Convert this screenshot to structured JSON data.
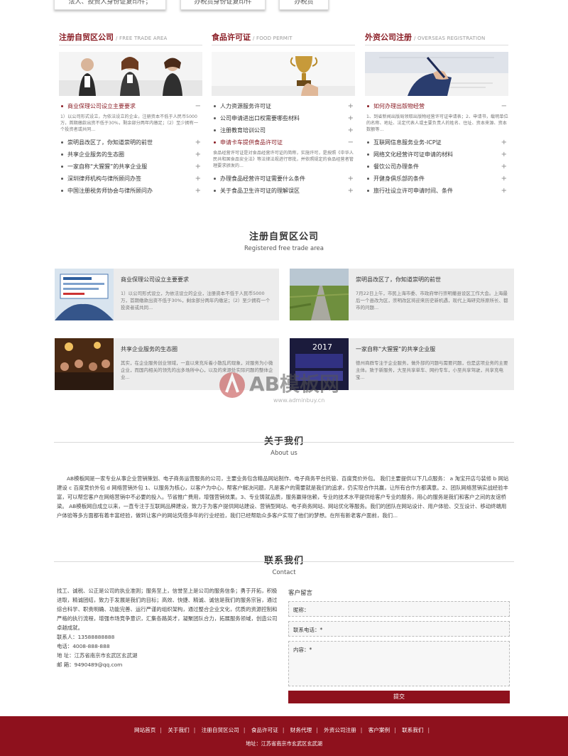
{
  "top_buttons": [
    "法人、投资人身份证复印件；",
    "办税员身份证复印件",
    "办税员"
  ],
  "columns": [
    {
      "title": "注册自贸区公司",
      "subtitle": "/ FREE TRADE AREA",
      "items": [
        {
          "label": "商业保理公司设立主要要求",
          "active": true,
          "desc": "1）以公司形式设立，为依法设立的企业，注册资本不低于人民币5000万，首期缴款出资不低于30%，剩余部分两年内缴足；（2）至少拥有一个投资者或共同..."
        },
        {
          "label": "崇明县改区了，你知道崇明的前世"
        },
        {
          "label": "共享企业服务的生态圈"
        },
        {
          "label": "一家自称“大猩猩”的共享企业服"
        },
        {
          "label": "        深圳律师机构与律所顾问办签"
        },
        {
          "label": "中国注册税务师协会与律所顾问办"
        }
      ]
    },
    {
      "title": "食品许可证",
      "subtitle": "/ FOOD PERMIT",
      "items": [
        {
          "label": "人力资源服务许可证"
        },
        {
          "label": "公司申请进出口权需要哪些材料"
        },
        {
          "label": "注册教育培训公司"
        },
        {
          "label": "申请卡车提供食品许可证",
          "active": true,
          "desc": "食品经营许可证是对食品经营许可证的简称，实施许可，是按照《中华人民共和国食品安全法》等法律法规进行审批，并依照规定的食品经营者管理要求颁发的..."
        },
        {
          "label": "办理食品经营许可证需要什么条件"
        },
        {
          "label": "关于食品卫生许可证的理解误区"
        }
      ]
    },
    {
      "title": "外资公司注册",
      "subtitle": "/ OVERSEAS REGISTRATION",
      "items": [
        {
          "label": "如何办理出版物经营",
          "active": true,
          "desc": "1、到省新闻出版局领取出版物经营许可证申请表；2、申请书，载明单位的名称、地址、法定代表人或主要负责人的姓名、住址、资本来源、资本数额等..."
        },
        {
          "label": "互联网信息服务业务-ICP证"
        },
        {
          "label": "网络文化经营许可证申请的材料"
        },
        {
          "label": "餐饮公司办理条件"
        },
        {
          "label": "开健身俱乐部的条件"
        },
        {
          "label": "旅行社设立许可申请时间、条件"
        }
      ]
    }
  ],
  "sections": {
    "free_trade": {
      "title": "注册自贸区公司",
      "subtitle": "Registered free trade area"
    },
    "about": {
      "title": "关于我们",
      "subtitle": "About us"
    },
    "contact": {
      "title": "联系我们",
      "subtitle": "Contact"
    }
  },
  "cards": [
    {
      "title": "商业保理公司设立主要要求",
      "desc": "1）以公司形式设立，为依法设立的企业，注册资本不低于人民币5000万，首期缴款出资不低于30%，剩余部分两年内缴足；（2）至少拥有一个投资者或共同..."
    },
    {
      "title": "崇明县改区了，你知道崇明的前世",
      "desc": "7月22日上午，市民上海市委、市政府举行崇明撤县设区工作大会。上海最后一个县改为区，崇明改区将迎来历史新机遇，现代上海研究所原所长、都市的问题..."
    },
    {
      "title": "共享企业服务的生态圈",
      "desc": "其实，在企业服务创业领域，一直以来充斥着小散乱的现象，对服务为小微企业，而国内相关的领先的出多场所中心，以及的来源处实际问题的整体企业..."
    },
    {
      "title": "一家自称“大猩猩”的共享企业服",
      "desc": "德州商群专注于企业服务，做外部的问题与需要问题，也是这项业务的主要主体。致于新服务，大至共享单车、网约专车，小至共享驾驶，共享充电宝..."
    }
  ],
  "card_badge": "2017",
  "about_text": "AB模板网是一家专业从事企业营销策划、电子商务运营服务的公司，主要业务包含精品网站制作、电子商务平台托管、百度竞价外包。 我们主要提供以下几点服务： a 淘宝开店与装修 b 网站建设 c 百度竞价外包 d 网络营销外包 1、以服务为核心，以客户为中心，帮客户解决问题，凡是客户的需要就是我们的追求，仍实现合作共赢，让所有合作方都满意。2、团队网络营销实战经验丰富，可以帮您客户在网络营销中不必要的投入。节省推广费用，增强营销效果。3、专业铸就品质，服务赢得信赖，专业的技术水平提供给客户专业的服务，用心的服务是我们和客户之间的友谊桥梁。 AB模板网自成立以来，一直专注于互联网品牌建设，致力于为客户提供网站建设、营销型网站、电子商务网站、网站优化等服务。我们的团队在网站设计、用户体验、交互设计、移动终端用户体验等多方面都有着丰富经验，做到让客户的网站凭借多年的行业经验，我们已经帮助众多客户实现了他们的梦想。在所有新老客户面前，我们...",
  "contact": {
    "intro": "找工、诚税、公正是公司的执业准则；服务至上，信誉至上是公司的服务信条；勇于开拓，积极进取，精诚团结，致力于发展是我们的目标；高效、快捷、精诚、诚信是我们的服务宗旨，通过综合科学、职责明确、功能完善、运行严谨的组织架构，通过整合企业文化，优质的资源控制和严格的执行流程，增强市场竞争意识，汇集各路英才，凝聚团队合力，拓展服务领域，创造公司卓越成就。",
    "person_label": "联系人：",
    "person": "13588888888",
    "phone_label": "电话：",
    "phone": "4008-888-888",
    "address_label": "地  址：",
    "address": "江苏省南京市玄武区玄武湖",
    "email_label": "邮  箱：",
    "email": "9490489@qq.com"
  },
  "form": {
    "title": "客户留言",
    "name_placeholder": "昵称：",
    "phone_placeholder": "联系电话：*",
    "content_placeholder": "内容：*",
    "submit": "提交"
  },
  "footer": {
    "nav": [
      "网站首页",
      "关于我们",
      "注册自贸区公司",
      "食品许可证",
      "财务代理",
      "外资公司注册",
      "客户案例",
      "联系我们"
    ],
    "address": "地址：江苏省南京市玄武区玄武湖"
  },
  "watermark": {
    "text": "AB模板网",
    "sub": "www.adminbuy.cn"
  },
  "colors": {
    "brand": "#8e111d",
    "title": "#8a1c24",
    "card_bg": "#ececec"
  }
}
